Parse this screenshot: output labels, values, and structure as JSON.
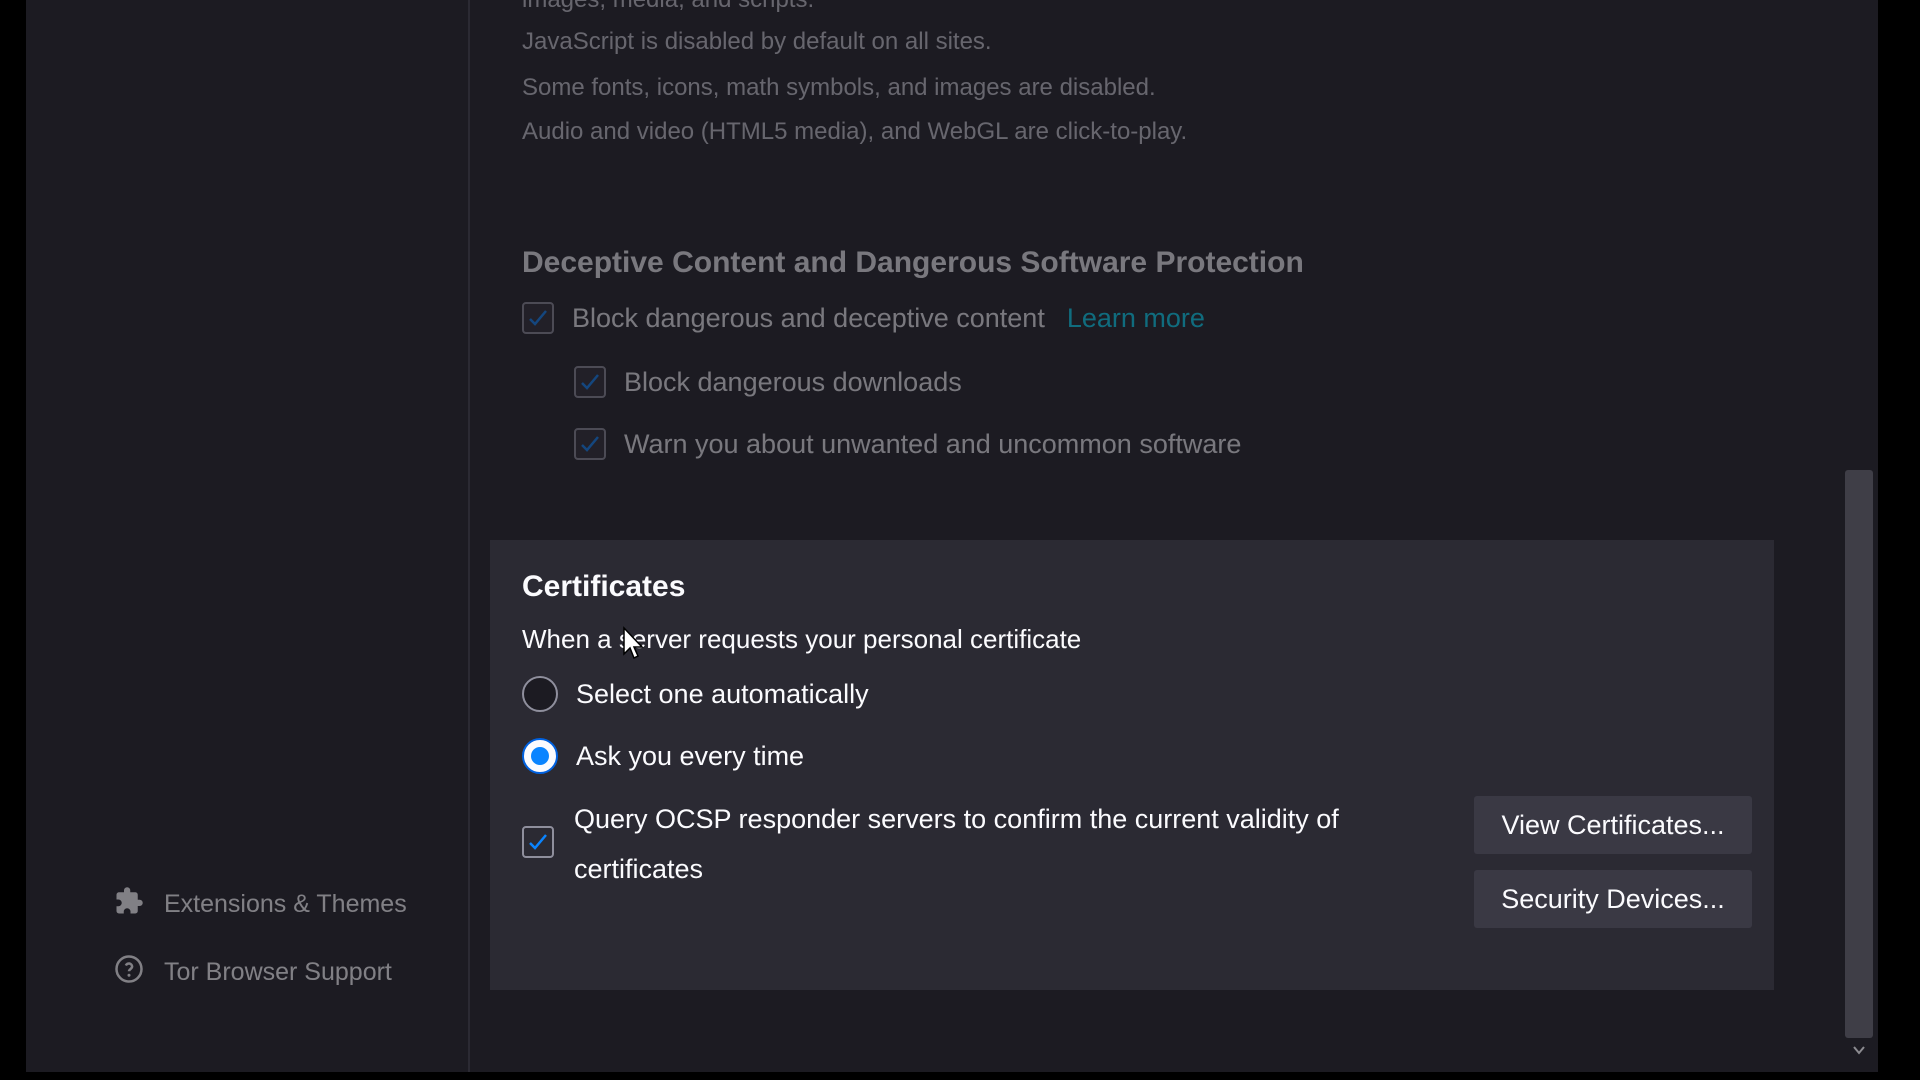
{
  "sidebar": {
    "items": [
      {
        "label": "Extensions & Themes",
        "icon": "puzzle-icon"
      },
      {
        "label": "Tor Browser Support",
        "icon": "help-icon"
      }
    ]
  },
  "security_level": {
    "cut_off_line": "images, media, and scripts.",
    "lines": [
      "JavaScript is disabled by default on all sites.",
      "Some fonts, icons, math symbols, and images are disabled.",
      "Audio and video (HTML5 media), and WebGL are click-to-play."
    ]
  },
  "deceptive": {
    "title": "Deceptive Content and Dangerous Software Protection",
    "block_label": "Block dangerous and deceptive content",
    "learn_more": "Learn more",
    "downloads_label": "Block dangerous downloads",
    "warn_label": "Warn you about unwanted and uncommon software",
    "block_checked": true,
    "downloads_checked": true,
    "warn_checked": true
  },
  "certificates": {
    "title": "Certificates",
    "prompt": "When a server requests your personal certificate",
    "options": [
      {
        "label": "Select one automatically",
        "selected": false
      },
      {
        "label": "Ask you every time",
        "selected": true
      }
    ],
    "ocsp_line1": "Query OCSP responder servers to confirm the current validity of",
    "ocsp_line2": "certificates",
    "ocsp_checked": true,
    "view_button": "View Certificates...",
    "devices_button": "Security Devices..."
  },
  "colors": {
    "background": "#1c1b22",
    "panel": "#2b2a33",
    "accent": "#0a84ff",
    "link": "#00ddff"
  }
}
